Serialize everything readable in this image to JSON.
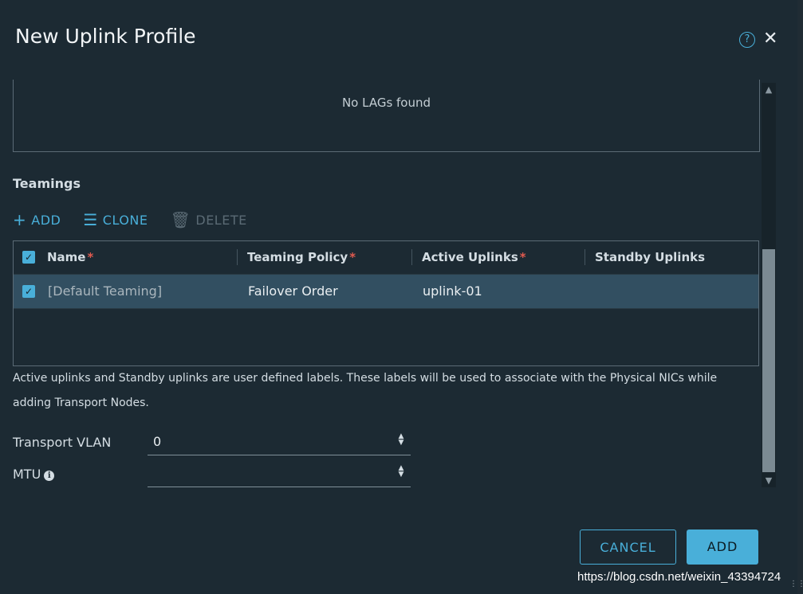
{
  "dialog": {
    "title": "New Uplink Profile",
    "help_icon": "?",
    "close_icon": "✕"
  },
  "lags": {
    "empty_text": "No LAGs found"
  },
  "teamings": {
    "section_title": "Teamings",
    "toolbar": {
      "add_label": "ADD",
      "clone_label": "CLONE",
      "delete_label": "DELETE"
    },
    "columns": [
      {
        "label": "Name",
        "required": "*"
      },
      {
        "label": "Teaming Policy",
        "required": "*"
      },
      {
        "label": "Active Uplinks",
        "required": "*"
      },
      {
        "label": "Standby Uplinks",
        "required": ""
      }
    ],
    "rows": [
      {
        "name": "[Default Teaming]",
        "policy": "Failover Order",
        "active": "uplink-01",
        "standby": ""
      }
    ]
  },
  "help_text": "Active uplinks and Standby uplinks are user defined labels. These labels will be used to associate with the Physical NICs while adding Transport Nodes.",
  "form": {
    "transport_vlan_label": "Transport VLAN",
    "transport_vlan_value": "0",
    "mtu_label": "MTU",
    "mtu_value": ""
  },
  "footer": {
    "cancel_label": "CANCEL",
    "add_label": "ADD"
  },
  "watermark": "https://blog.csdn.net/weixin_43394724",
  "colors": {
    "background": "#1c2a33",
    "accent": "#49afd9",
    "selected_row": "#324f61",
    "required": "#e05a4f"
  }
}
